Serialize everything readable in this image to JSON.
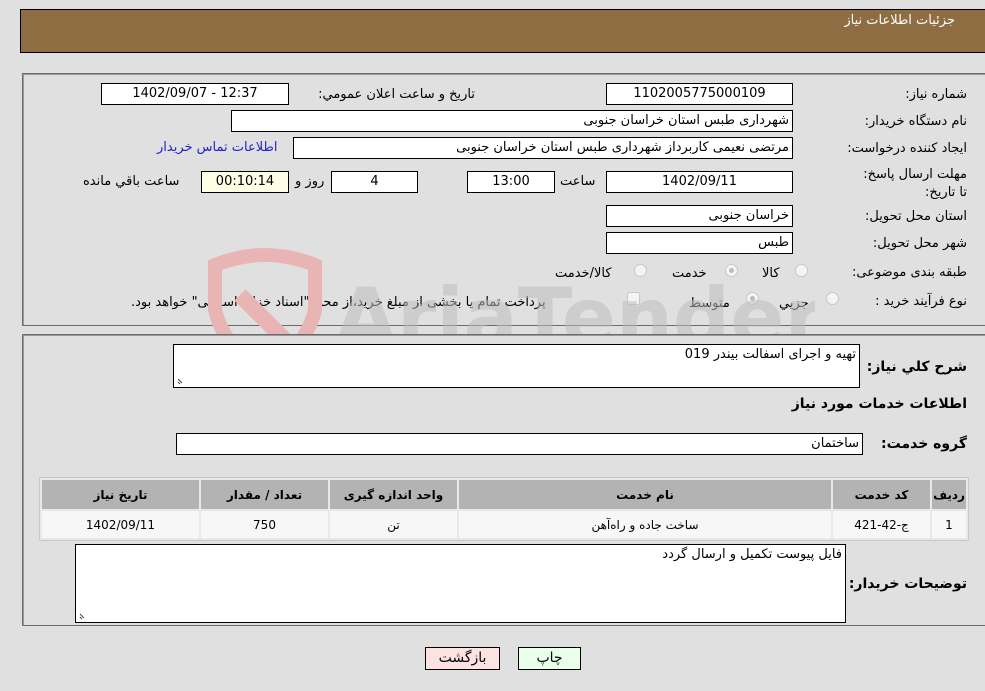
{
  "header": {
    "title": "جزئیات اطلاعات نیاز"
  },
  "fields": {
    "need_number": {
      "label": "شماره نیاز:",
      "value": "1102005775000109"
    },
    "announce_datetime": {
      "label": "تاریخ و ساعت اعلان عمومي:",
      "value": "1402/09/07 - 12:37"
    },
    "buyer_org": {
      "label": "نام دستگاه خریدار:",
      "value": "شهرداری طبس استان خراسان جنوبی"
    },
    "requester": {
      "label": "ایجاد کننده درخواست:",
      "value": "مرتضی نعیمی کاربرداز شهرداری طبس استان خراسان جنوبی"
    },
    "buyer_contact_link": "اطلاعات تماس خریدار",
    "deadline": {
      "label": "مهلت ارسال پاسخ: تا تاریخ:",
      "date": "1402/09/11",
      "time_label": "ساعت",
      "time": "13:00",
      "days": "4",
      "days_label": "روز و",
      "remaining": "00:10:14",
      "remaining_label": "ساعت باقي مانده"
    },
    "delivery_province": {
      "label": "استان محل تحویل:",
      "value": "خراسان جنوبی"
    },
    "delivery_city": {
      "label": "شهر محل تحویل:",
      "value": "طبس"
    },
    "category": {
      "label": "طبقه بندی موضوعی:",
      "options": [
        "کالا",
        "خدمت",
        "کالا/خدمت"
      ],
      "selected": "خدمت"
    },
    "purchase_type": {
      "label": "نوع فرآیند خرید :",
      "options": [
        "جزيي",
        "متوسط"
      ],
      "selected": "متوسط",
      "treasury_note": "پرداخت تمام یا بخشی از مبلغ خرید،از محل \"اسناد خزانه اسلامی\" خواهد بود."
    }
  },
  "details": {
    "description_label": "شرح کلي نیاز:",
    "description": "تهیه و اجرای اسفالت بیندر 019",
    "services_heading": "اطلاعات خدمات مورد نیاز",
    "service_group_label": "گروه خدمت:",
    "service_group": "ساختمان",
    "table": {
      "headers": [
        "ردیف",
        "کد خدمت",
        "نام خدمت",
        "واحد اندازه گیری",
        "تعداد / مقدار",
        "تاریخ نیاز"
      ],
      "rows": [
        [
          "1",
          "ج-42-421",
          "ساخت جاده و راه‌آهن",
          "تن",
          "750",
          "1402/09/11"
        ]
      ]
    },
    "buyer_notes_label": "توضیحات خریدار:",
    "buyer_notes": "فایل پیوست تکمیل و ارسال گردد"
  },
  "buttons": {
    "print": "چاپ",
    "back": "بازگشت"
  },
  "watermark": "AriaTender.neT"
}
